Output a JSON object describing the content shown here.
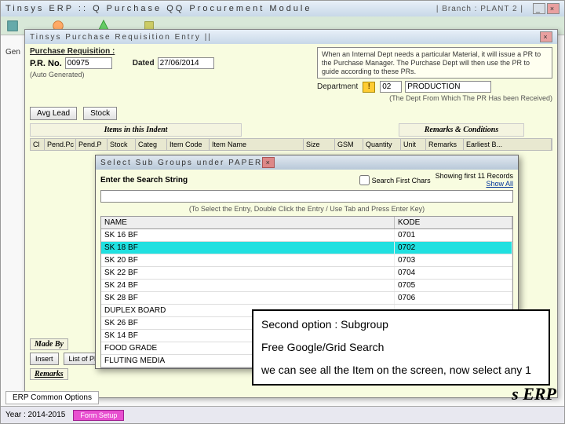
{
  "app": {
    "title": "Tinsys ERP :: Q Purchase QQ Procurement Module",
    "branch": "| Branch : PLANT 2 |"
  },
  "gen_label": "Gen",
  "sub": {
    "title": "Tinsys Purchase Requisition Entry ||",
    "section": "Purchase Requisition :",
    "prno_label": "P.R. No.",
    "prno_value": "00975",
    "dated_label": "Dated",
    "dated_value": "27/06/2014",
    "autogen": "(Auto Generated)",
    "dept_label": "Department",
    "dept_code": "02",
    "dept_name": "PRODUCTION",
    "dept_hint": "(The Dept From Which The PR Has been Received)",
    "info": "When an Internal Dept needs a particular Material, it will issue a PR to the Purchase Manager. The Purchase Dept will then use the PR to guide according to these PRs.",
    "avg_lead": "Avg Lead",
    "stock": "Stock",
    "items_hdr": "Items in this Indent",
    "remcond_hdr": "Remarks & Conditions",
    "cols": {
      "cl": "Cl",
      "pendpc": "Pend.Pc",
      "pendp": "Pend.P",
      "stock": "Stock",
      "categ": "Categ",
      "itemcode": "Item Code",
      "itemname": "Item Name",
      "size": "Size",
      "gsm": "GSM",
      "qty": "Quantity",
      "unit": "Unit",
      "remarks": "Remarks",
      "earliest": "Earliest B..."
    },
    "madeby": "Made By",
    "insert_btn": "Insert",
    "listpr_btn": "List of PR",
    "remarks_section": "Remarks"
  },
  "dlg": {
    "title": "Select Sub Groups under PAPER",
    "search_label": "Enter the Search String",
    "chk_label": "Search First Chars",
    "record_line": "Showing first 11 Records",
    "show_all": "Show All",
    "hint": "(To Select the Entry, Double Click the Entry / Use Tab and Press Enter Key)",
    "col_name": "NAME",
    "col_kode": "KODE",
    "rows": [
      {
        "name": "SK 16 BF",
        "kode": "0701"
      },
      {
        "name": "SK 18 BF",
        "kode": "0702"
      },
      {
        "name": "SK 20 BF",
        "kode": "0703"
      },
      {
        "name": "SK 22 BF",
        "kode": "0704"
      },
      {
        "name": "SK 24 BF",
        "kode": "0705"
      },
      {
        "name": "SK 28 BF",
        "kode": "0706"
      },
      {
        "name": "DUPLEX BOARD",
        "kode": ""
      },
      {
        "name": "SK 26 BF",
        "kode": ""
      },
      {
        "name": "SK 14 BF",
        "kode": ""
      },
      {
        "name": "FOOD GRADE",
        "kode": ""
      },
      {
        "name": "FLUTING MEDIA",
        "kode": ""
      }
    ],
    "selected_index": 1
  },
  "status": {
    "year": "Year : 2014-2015",
    "pink": "Form Setup",
    "erp_common": "ERP Common Options"
  },
  "callout": {
    "line1": "Second option : Subgroup",
    "line2": "Free Google/Grid Search",
    "line3": "we can see all the Item on the screen, now select any 1"
  },
  "brand": "s ERP"
}
